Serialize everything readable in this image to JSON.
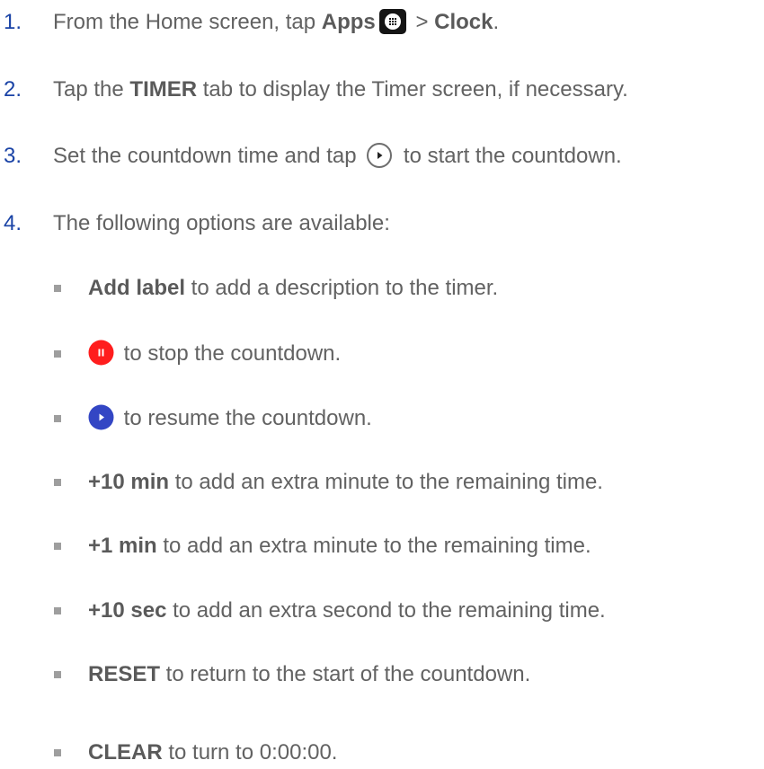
{
  "steps": [
    {
      "num": "1.",
      "pre": "From the Home screen, tap ",
      "b1": "Apps",
      "mid": " > ",
      "b2": "Clock",
      "post": "."
    },
    {
      "num": "2.",
      "pre": "Tap the ",
      "bold": "TIMER",
      "post": " tab to display the Timer screen, if necessary."
    },
    {
      "num": "3.",
      "pre": "Set the countdown time and tap ",
      "post": " to start the countdown."
    },
    {
      "num": "4.",
      "text": "The following options are available:"
    }
  ],
  "options": [
    {
      "bold": "Add label",
      "text": " to add a description to the timer."
    },
    {
      "text": " to stop the countdown.",
      "icon": "pause-icon",
      "color": "#ff1d1d"
    },
    {
      "text": " to resume the countdown.",
      "icon": "play-icon",
      "color": "#3346c4"
    },
    {
      "bold": "+10 min",
      "text": " to add an extra minute to the remaining time."
    },
    {
      "bold": "+1 min",
      "text": " to add an extra minute to the remaining time."
    },
    {
      "bold": "+10 sec",
      "text": " to add an extra second to the remaining time."
    },
    {
      "bold": "RESET",
      "text": " to return to the start of the countdown."
    },
    {
      "bold": "CLEAR",
      "text": " to turn to 0:00:00."
    }
  ],
  "icons": {
    "apps": "apps-icon",
    "play_outline": "play-outline-icon"
  },
  "colors": {
    "step_number": "#1a43a6",
    "text": "#626262",
    "bullet": "#9e9e9e"
  }
}
